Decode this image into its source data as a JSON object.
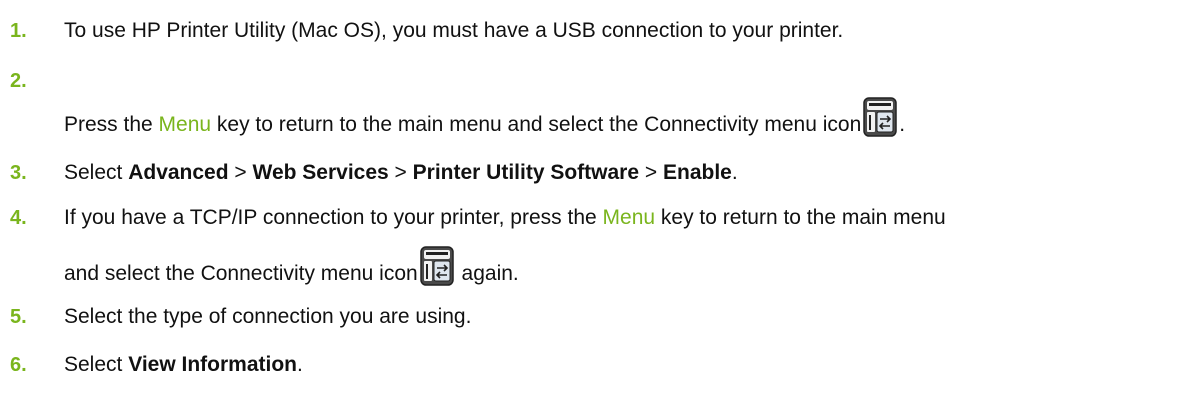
{
  "colors": {
    "accent": "#7ab51d",
    "text": "#111111"
  },
  "icons": {
    "connectivity": "connectivity-menu-icon"
  },
  "steps": [
    {
      "number": "1.",
      "text": "To use HP Printer Utility (Mac OS), you must have a USB connection to your printer."
    },
    {
      "number": "2.",
      "pre": "Press the ",
      "key": "Menu",
      "post": " key to return to the main menu and select the Connectivity menu icon",
      "end": "."
    },
    {
      "number": "3.",
      "pre": "Select ",
      "b1": "Advanced",
      "sep1": " > ",
      "b2": "Web Services",
      "sep2": " > ",
      "b3": "Printer Utility Software",
      "sep3": " > ",
      "b4": "Enable",
      "end": "."
    },
    {
      "number": "4.",
      "pre": "If you have a TCP/IP connection to your printer, press the ",
      "key": "Menu",
      "post": " key to return to the main menu",
      "line2": "and select the Connectivity menu icon",
      "end": " again."
    },
    {
      "number": "5.",
      "text": "Select the type of connection you are using."
    },
    {
      "number": "6.",
      "pre": "Select ",
      "b1": "View Information",
      "end": "."
    }
  ]
}
